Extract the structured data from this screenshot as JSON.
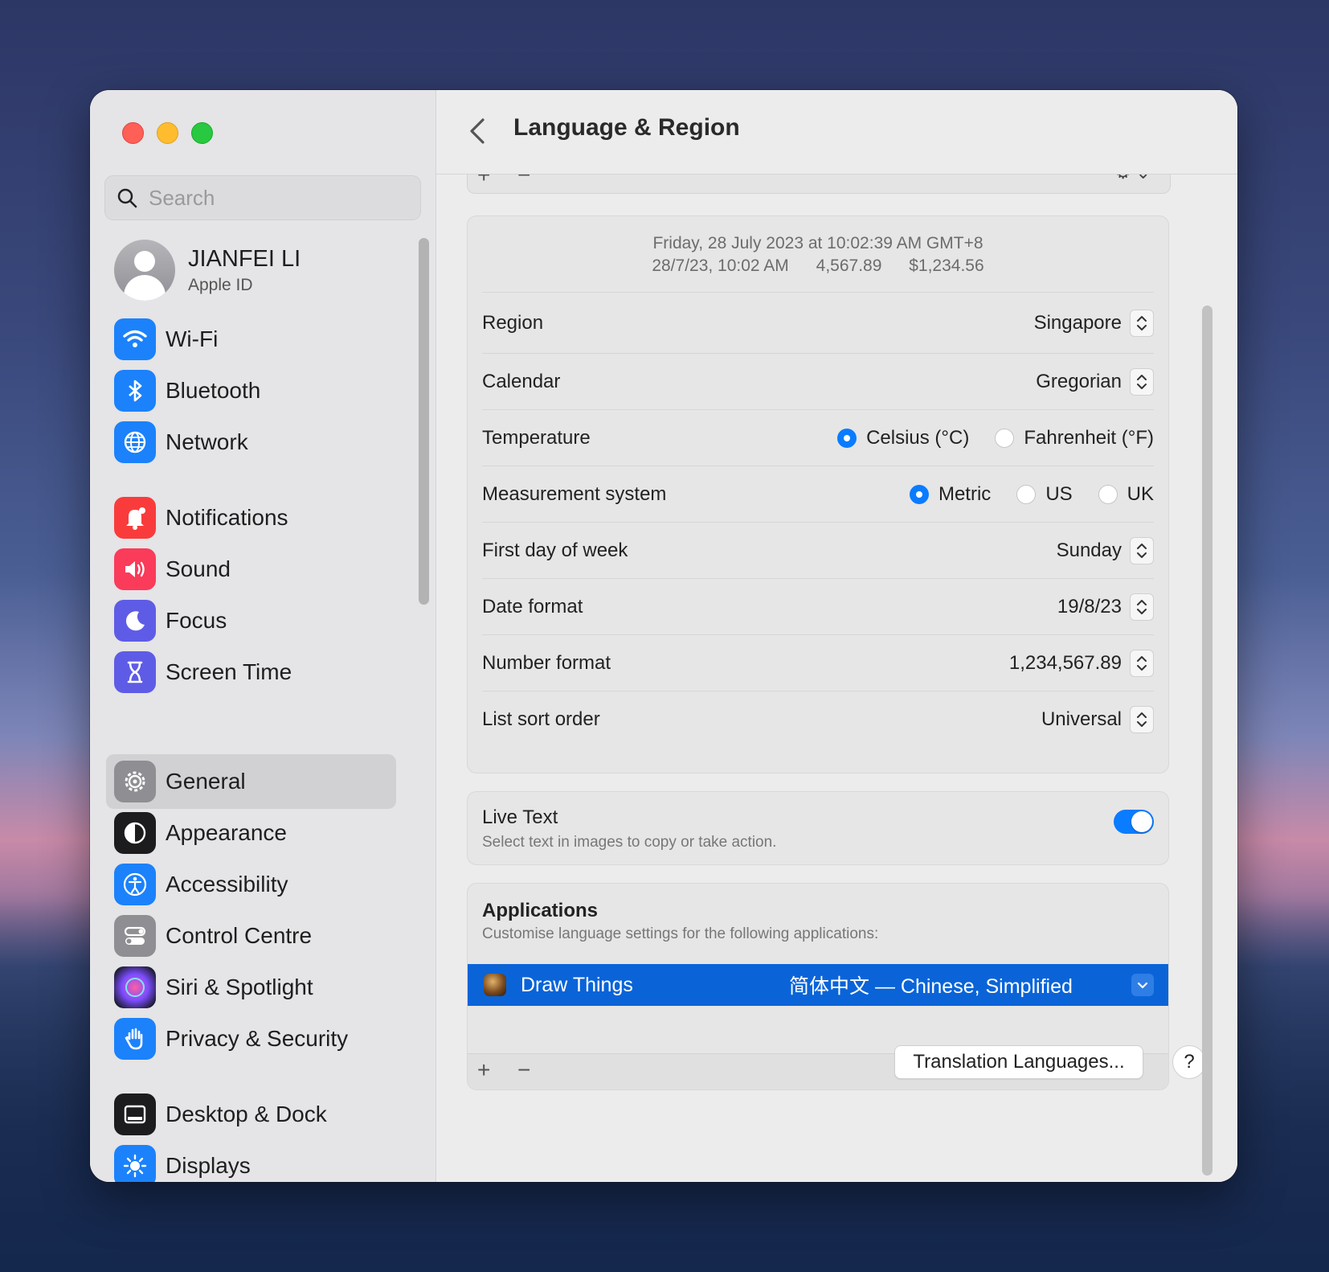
{
  "window": {
    "title": "Language & Region"
  },
  "search": {
    "placeholder": "Search"
  },
  "account": {
    "name": "JIANFEI LI",
    "subtitle": "Apple ID"
  },
  "sidebar": {
    "items": [
      {
        "label": "Wi-Fi",
        "icon": "wifi-icon",
        "color": "#1b82fb"
      },
      {
        "label": "Bluetooth",
        "icon": "bluetooth-icon",
        "color": "#1b82fb"
      },
      {
        "label": "Network",
        "icon": "globe-icon",
        "color": "#1b82fb"
      },
      {
        "label": "Notifications",
        "icon": "bell-icon",
        "color": "#fa3b3b"
      },
      {
        "label": "Sound",
        "icon": "speaker-icon",
        "color": "#fa3b5a"
      },
      {
        "label": "Focus",
        "icon": "moon-icon",
        "color": "#5e5ce6"
      },
      {
        "label": "Screen Time",
        "icon": "hourglass-icon",
        "color": "#5e5ce6"
      },
      {
        "label": "General",
        "icon": "gear-icon",
        "color": "#8e8e93",
        "selected": true
      },
      {
        "label": "Appearance",
        "icon": "appearance-icon",
        "color": "#1c1c1e"
      },
      {
        "label": "Accessibility",
        "icon": "accessibility-icon",
        "color": "#1b82fb"
      },
      {
        "label": "Control Centre",
        "icon": "control-centre-icon",
        "color": "#8e8e93"
      },
      {
        "label": "Siri & Spotlight",
        "icon": "siri-icon",
        "color": "#6a3fb5"
      },
      {
        "label": "Privacy & Security",
        "icon": "hand-icon",
        "color": "#1b82fb"
      },
      {
        "label": "Desktop & Dock",
        "icon": "dock-icon",
        "color": "#1c1c1e"
      },
      {
        "label": "Displays",
        "icon": "sun-icon",
        "color": "#1b82fb"
      }
    ]
  },
  "language_list_footer": {
    "add": "+",
    "remove": "−"
  },
  "preview": {
    "line1": "Friday, 28 July 2023 at 10:02:39 AM GMT+8",
    "date_short": "28/7/23, 10:02 AM",
    "number": "4,567.89",
    "currency": "$1,234.56"
  },
  "settings": {
    "region": {
      "label": "Region",
      "value": "Singapore"
    },
    "calendar": {
      "label": "Calendar",
      "value": "Gregorian"
    },
    "temperature": {
      "label": "Temperature",
      "options": [
        "Celsius (°C)",
        "Fahrenheit (°F)"
      ],
      "selected": "Celsius (°C)"
    },
    "measurement": {
      "label": "Measurement system",
      "options": [
        "Metric",
        "US",
        "UK"
      ],
      "selected": "Metric"
    },
    "first_day": {
      "label": "First day of week",
      "value": "Sunday"
    },
    "date_format": {
      "label": "Date format",
      "value": "19/8/23"
    },
    "number_format": {
      "label": "Number format",
      "value": "1,234,567.89"
    },
    "sort_order": {
      "label": "List sort order",
      "value": "Universal"
    }
  },
  "live_text": {
    "title": "Live Text",
    "description": "Select text in images to copy or take action.",
    "enabled": true
  },
  "applications": {
    "title": "Applications",
    "description": "Customise language settings for the following applications:",
    "rows": [
      {
        "name": "Draw Things",
        "language": "简体中文 — Chinese, Simplified"
      }
    ],
    "add": "+",
    "remove": "−"
  },
  "buttons": {
    "translation": "Translation Languages...",
    "help": "?"
  },
  "colors": {
    "accent": "#0a7cff",
    "selection": "#0a64d8"
  }
}
